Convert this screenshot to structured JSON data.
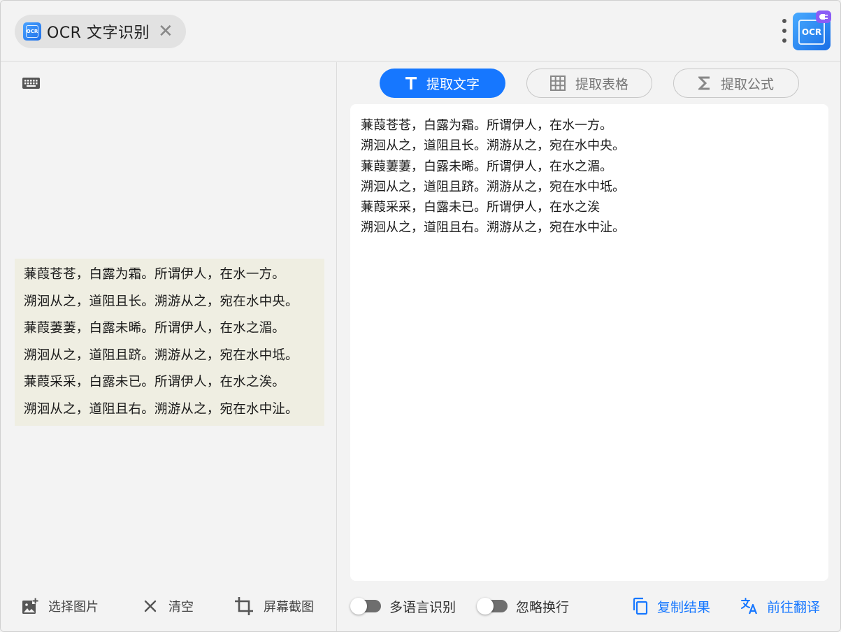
{
  "titlebar": {
    "tab_icon_text": "OCR",
    "tab_title": "OCR 文字识别",
    "close_glyph": "✕",
    "logo_text": "OCR"
  },
  "left": {
    "image_lines": [
      "蒹葭苍苍，白露为霜。所谓伊人，在水一方。",
      "溯洄从之，道阻且长。溯游从之，宛在水中央。",
      "蒹葭萋萋，白露未晞。所谓伊人，在水之湄。",
      "溯洄从之，道阻且跻。溯游从之，宛在水中坻。",
      "蒹葭采采，白露未已。所谓伊人，在水之涘。",
      "溯洄从之，道阻且右。溯游从之，宛在水中沚。"
    ],
    "toolbar": {
      "select_image": "选择图片",
      "clear": "清空",
      "screenshot": "屏幕截图"
    }
  },
  "right": {
    "tabs": [
      {
        "label": "提取文字",
        "icon": "text-T-icon",
        "active": true
      },
      {
        "label": "提取表格",
        "icon": "table-grid-icon",
        "active": false
      },
      {
        "label": "提取公式",
        "icon": "sigma-icon",
        "active": false
      }
    ],
    "result_lines": [
      "蒹葭苍苍，白露为霜。所谓伊人，在水一方。",
      "溯洄从之，道阻且长。溯游从之，宛在水中央。",
      "蒹葭萋萋，白露未晞。所谓伊人，在水之湄。",
      "溯洄从之，道阻且跻。溯游从之，宛在水中坻。",
      "蒹葭采采，白露未已。所谓伊人，在水之涘",
      "溯洄从之，道阻且右。溯游从之，宛在水中沚。"
    ],
    "toolbar": {
      "multi_lang": "多语言识别",
      "ignore_newline": "忽略换行",
      "copy_result": "复制结果",
      "translate": "前往翻译"
    }
  },
  "colors": {
    "accent": "#1677ff",
    "panel_bg": "#f3f3f3",
    "image_bg": "#efeee2",
    "badge": "#8a5cf6"
  }
}
